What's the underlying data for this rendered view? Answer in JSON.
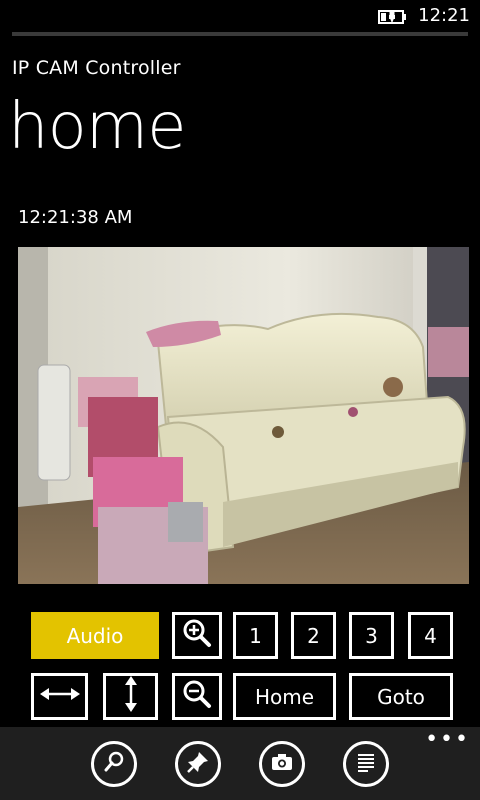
{
  "status_bar": {
    "time": "12:21",
    "battery_icon": "battery-charging-icon"
  },
  "header": {
    "app_title": "IP CAM Controller",
    "page_title": "home"
  },
  "camera": {
    "timestamp": "12:21:38 AM",
    "feed": "live-camera-image"
  },
  "controls": {
    "row1": [
      {
        "name": "audio-button",
        "label": "Audio",
        "accent": true
      },
      {
        "name": "zoom-in-button",
        "icon": "zoom-in-icon"
      },
      {
        "name": "preset-1-button",
        "label": "1"
      },
      {
        "name": "preset-2-button",
        "label": "2"
      },
      {
        "name": "preset-3-button",
        "label": "3"
      },
      {
        "name": "preset-4-button",
        "label": "4"
      }
    ],
    "row2": [
      {
        "name": "pan-horizontal-button",
        "icon": "horizontal-arrows-icon"
      },
      {
        "name": "pan-vertical-button",
        "icon": "vertical-arrows-icon"
      },
      {
        "name": "zoom-out-button",
        "icon": "zoom-out-icon"
      },
      {
        "name": "home-button",
        "label": "Home"
      },
      {
        "name": "goto-button",
        "label": "Goto"
      }
    ]
  },
  "app_bar": {
    "buttons": [
      {
        "name": "search-button",
        "icon": "search-icon"
      },
      {
        "name": "pin-button",
        "icon": "pin-icon"
      },
      {
        "name": "camera-button",
        "icon": "camera-icon"
      },
      {
        "name": "list-button",
        "icon": "list-icon"
      }
    ],
    "more": "•••"
  },
  "colors": {
    "accent": "#e3c300",
    "background": "#000000",
    "app_bar": "#1f1f1f"
  }
}
